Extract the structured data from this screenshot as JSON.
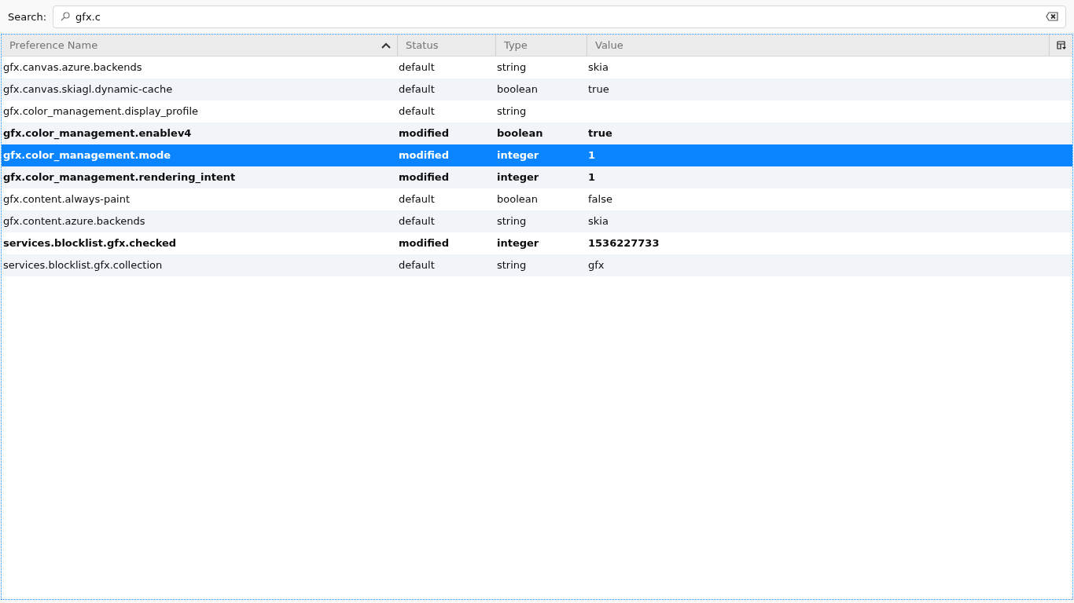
{
  "search": {
    "label": "Search:",
    "value": "gfx.c"
  },
  "table": {
    "columns": [
      {
        "label": "Preference Name",
        "sorted": true
      },
      {
        "label": "Status",
        "sorted": false
      },
      {
        "label": "Type",
        "sorted": false
      },
      {
        "label": "Value",
        "sorted": false
      }
    ],
    "rows": [
      {
        "cells": [
          "gfx.canvas.azure.backends",
          "default",
          "string",
          "skia"
        ],
        "modified": false,
        "selected": false
      },
      {
        "cells": [
          "gfx.canvas.skiagl.dynamic-cache",
          "default",
          "boolean",
          "true"
        ],
        "modified": false,
        "selected": false
      },
      {
        "cells": [
          "gfx.color_management.display_profile",
          "default",
          "string",
          ""
        ],
        "modified": false,
        "selected": false
      },
      {
        "cells": [
          "gfx.color_management.enablev4",
          "modified",
          "boolean",
          "true"
        ],
        "modified": true,
        "selected": false
      },
      {
        "cells": [
          "gfx.color_management.mode",
          "modified",
          "integer",
          "1"
        ],
        "modified": true,
        "selected": true
      },
      {
        "cells": [
          "gfx.color_management.rendering_intent",
          "modified",
          "integer",
          "1"
        ],
        "modified": true,
        "selected": false
      },
      {
        "cells": [
          "gfx.content.always-paint",
          "default",
          "boolean",
          "false"
        ],
        "modified": false,
        "selected": false
      },
      {
        "cells": [
          "gfx.content.azure.backends",
          "default",
          "string",
          "skia"
        ],
        "modified": false,
        "selected": false
      },
      {
        "cells": [
          "services.blocklist.gfx.checked",
          "modified",
          "integer",
          "1536227733"
        ],
        "modified": true,
        "selected": false
      },
      {
        "cells": [
          "services.blocklist.gfx.collection",
          "default",
          "string",
          "gfx"
        ],
        "modified": false,
        "selected": false
      }
    ]
  }
}
